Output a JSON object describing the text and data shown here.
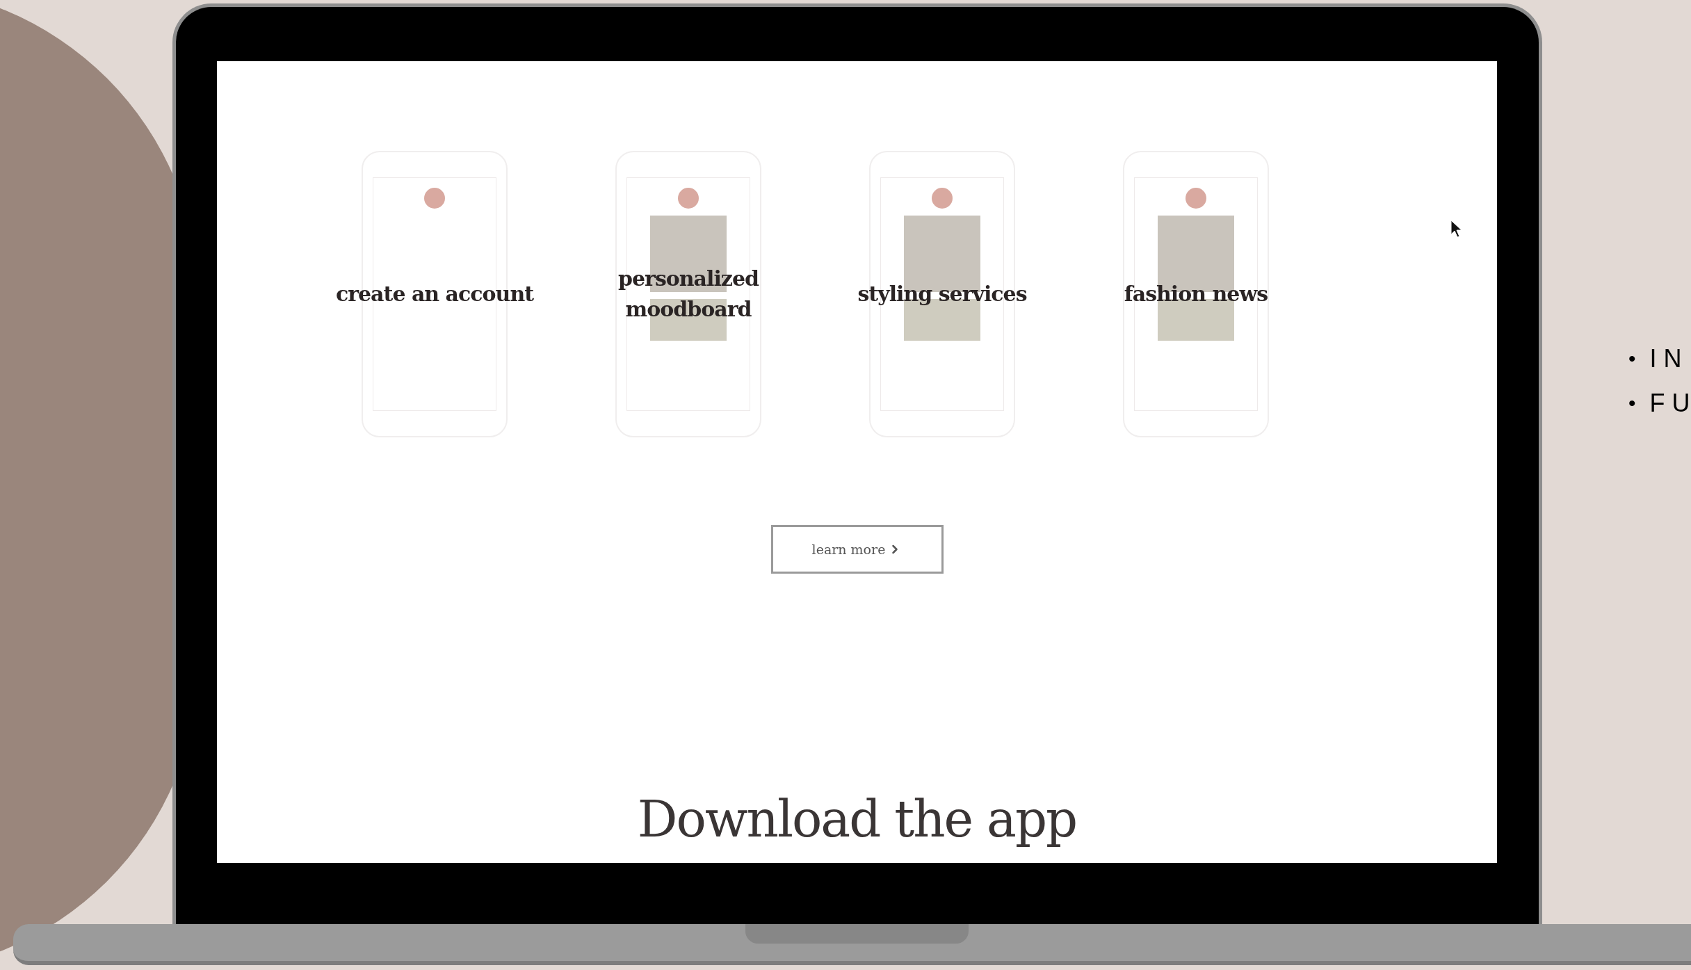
{
  "features": [
    {
      "label": "create an account"
    },
    {
      "label": "personalized moodboard"
    },
    {
      "label": "styling services"
    },
    {
      "label": "fashion news"
    }
  ],
  "learn_more_button": {
    "label": "learn more"
  },
  "download_heading": "Download the app",
  "side_list": [
    {
      "bullet": "•",
      "text": "IN"
    },
    {
      "bullet": "•",
      "text": "FU"
    }
  ]
}
